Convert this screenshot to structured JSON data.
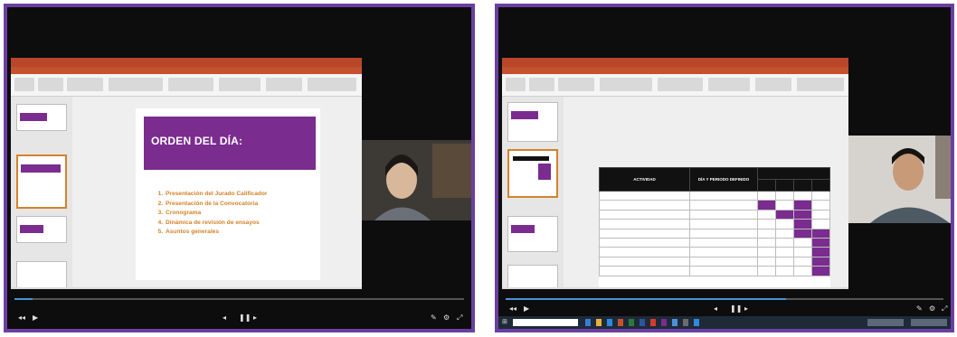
{
  "colors": {
    "frame_border": "#6b3fa0",
    "brand_purple": "#7a2c8f",
    "accent_orange": "#d4822b",
    "ppt_titlebar": "#b8472a",
    "progress_fill": "#4a90d9"
  },
  "window_left": {
    "slide": {
      "title": "ORDEN DEL DÍA:",
      "agenda": [
        "Presentación del Jurado Calificador",
        "Presentación de la Convocatoria",
        "Cronograma",
        "Dinámica de revisión de ensayos",
        "Asuntos generales"
      ]
    },
    "camera": {
      "name": ""
    },
    "player": {
      "progress": 0.04
    }
  },
  "window_right": {
    "slide": {
      "table_columns": [
        "ACTIVIDAD",
        "DÍA Y PERIODO DEFINIDO"
      ],
      "month_header": "",
      "week_headers": [
        "",
        "",
        "",
        ""
      ],
      "rows": [
        {
          "activity": "",
          "period": "",
          "weeks": [
            false,
            false,
            false,
            false
          ]
        },
        {
          "activity": "",
          "period": "",
          "weeks": [
            true,
            false,
            true,
            false
          ]
        },
        {
          "activity": "",
          "period": "",
          "weeks": [
            false,
            true,
            true,
            false
          ]
        },
        {
          "activity": "",
          "period": "",
          "weeks": [
            false,
            false,
            true,
            false
          ]
        },
        {
          "activity": "",
          "period": "",
          "weeks": [
            false,
            false,
            true,
            true
          ]
        },
        {
          "activity": "",
          "period": "",
          "weeks": [
            false,
            false,
            false,
            true
          ]
        },
        {
          "activity": "",
          "period": "",
          "weeks": [
            false,
            false,
            false,
            true
          ]
        },
        {
          "activity": "",
          "period": "",
          "weeks": [
            false,
            false,
            false,
            true
          ]
        },
        {
          "activity": "",
          "period": "",
          "weeks": [
            false,
            false,
            false,
            true
          ]
        }
      ]
    },
    "camera": {
      "name": ""
    },
    "player": {
      "progress": 0.64
    },
    "taskbar": {
      "search_placeholder": ""
    }
  }
}
